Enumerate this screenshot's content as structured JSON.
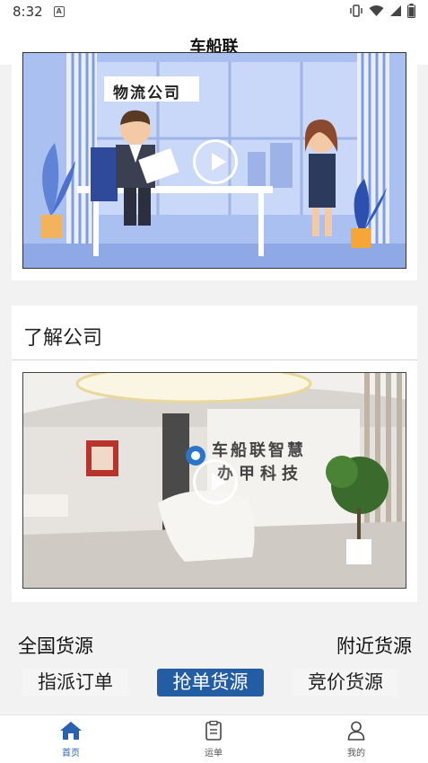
{
  "status_bar": {
    "time": "8:32",
    "notification_icon": "a-icon",
    "icons": [
      "vibrate-icon",
      "wifi-icon",
      "signal-icon",
      "battery-icon"
    ]
  },
  "header": {
    "title": "车船联"
  },
  "video1": {
    "sign_text": "物流公司"
  },
  "about": {
    "title": "了解公司"
  },
  "video2": {
    "wall_text_line1": "车船联智慧",
    "wall_text_line2": "办甲科技"
  },
  "links": {
    "left": "全国货源",
    "right": "附近货源"
  },
  "tabs": [
    {
      "label": "指派订单",
      "active": false
    },
    {
      "label": "抢单货源",
      "active": true
    },
    {
      "label": "竞价货源",
      "active": false
    }
  ],
  "bottom_nav": [
    {
      "label": "首页",
      "icon": "home-icon",
      "active": true
    },
    {
      "label": "运单",
      "icon": "clipboard-icon",
      "active": false
    },
    {
      "label": "我的",
      "icon": "user-icon",
      "active": false
    }
  ],
  "colors": {
    "accent": "#235da3",
    "nav_active": "#2a62b0"
  }
}
